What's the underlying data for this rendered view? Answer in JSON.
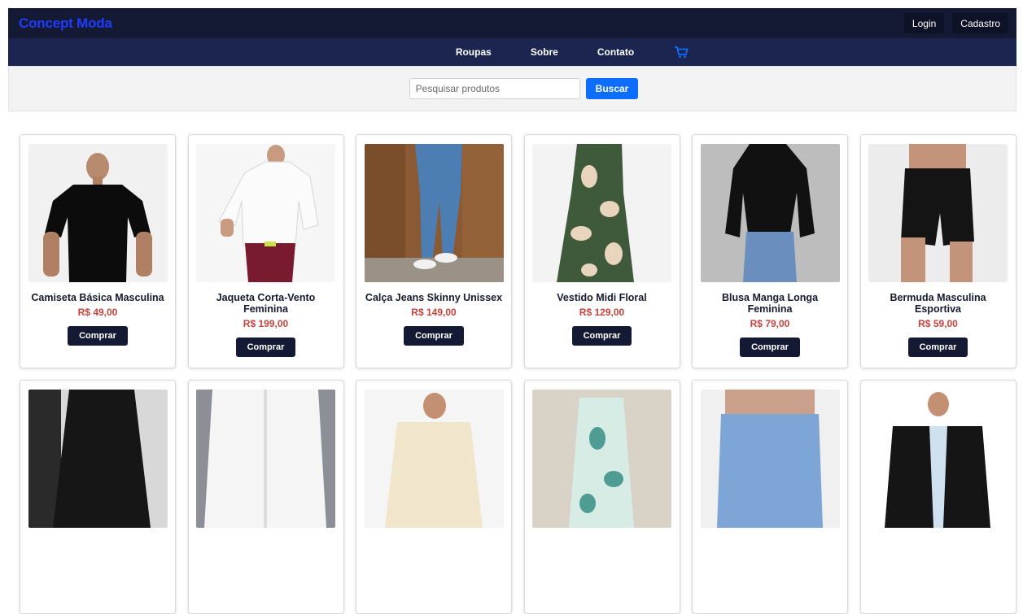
{
  "brand": "Concept Moda",
  "auth": {
    "login": "Login",
    "signup": "Cadastro"
  },
  "nav": {
    "items": [
      "Roupas",
      "Sobre",
      "Contato"
    ],
    "cart_icon": "cart-icon"
  },
  "search": {
    "placeholder": "Pesquisar produtos",
    "value": "",
    "button": "Buscar"
  },
  "colors": {
    "topbar": "#141a33",
    "navbar": "#1b2550",
    "brand": "#1e3cff",
    "accent": "#0d6efd",
    "price": "#c8423c"
  },
  "products": [
    {
      "name": "Camiseta Básica Masculina",
      "price": "R$ 49,00",
      "button": "Comprar"
    },
    {
      "name": "Jaqueta Corta-Vento Feminina",
      "price": "R$ 199,00",
      "button": "Comprar"
    },
    {
      "name": "Calça Jeans Skinny Unissex",
      "price": "R$ 149,00",
      "button": "Comprar"
    },
    {
      "name": "Vestido Midi Floral",
      "price": "R$ 129,00",
      "button": "Comprar"
    },
    {
      "name": "Blusa Manga Longa Feminina",
      "price": "R$ 79,00",
      "button": "Comprar"
    },
    {
      "name": "Bermuda Masculina Esportiva",
      "price": "R$ 59,00",
      "button": "Comprar"
    }
  ]
}
